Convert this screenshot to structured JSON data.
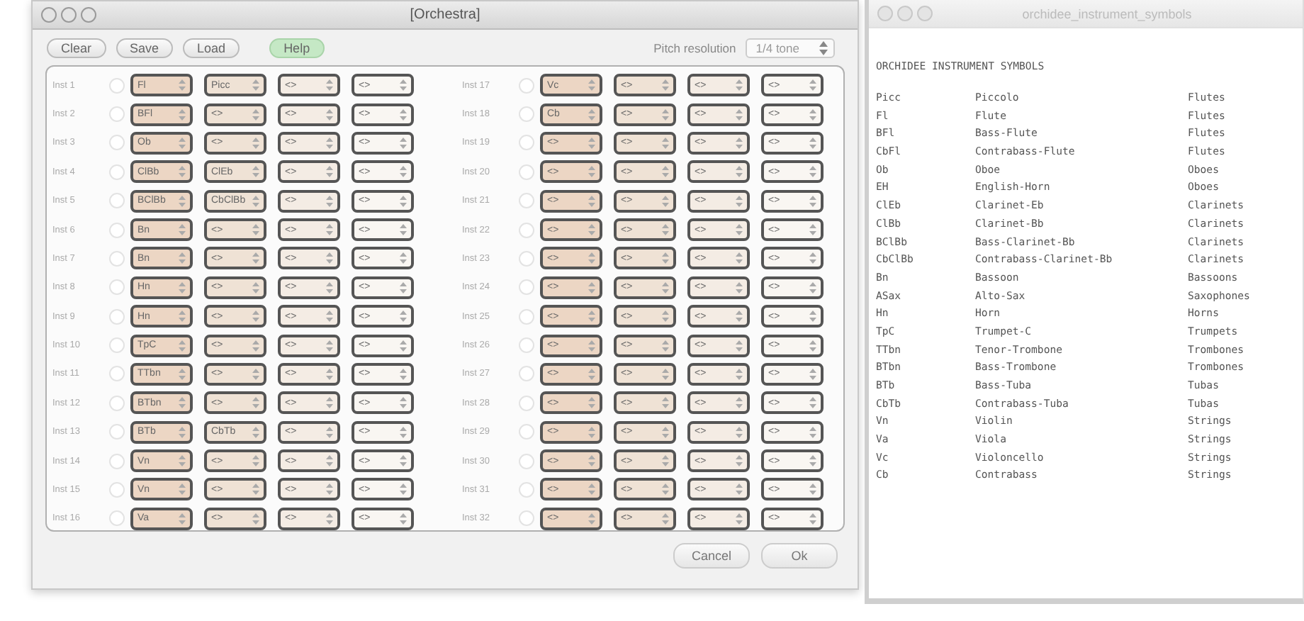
{
  "main_window": {
    "title": "[Orchestra]",
    "toolbar": {
      "buttons": [
        {
          "label": "Clear",
          "kind": "plain"
        },
        {
          "label": "Save",
          "kind": "plain"
        },
        {
          "label": "Load",
          "kind": "plain"
        },
        {
          "label": "Help",
          "kind": "help"
        }
      ],
      "pitch_label": "Pitch resolution",
      "pitch_value": "1/4 tone"
    },
    "instruments": [
      {
        "label": "Inst 1",
        "selected": false,
        "slots": [
          "Fl",
          "Picc",
          "<>",
          "<>"
        ]
      },
      {
        "label": "Inst 2",
        "selected": false,
        "slots": [
          "BFl",
          "<>",
          "<>",
          "<>"
        ]
      },
      {
        "label": "Inst 3",
        "selected": false,
        "slots": [
          "Ob",
          "<>",
          "<>",
          "<>"
        ]
      },
      {
        "label": "Inst 4",
        "selected": false,
        "slots": [
          "ClBb",
          "ClEb",
          "<>",
          "<>"
        ]
      },
      {
        "label": "Inst 5",
        "selected": false,
        "slots": [
          "BClBb",
          "CbClBb",
          "<>",
          "<>"
        ]
      },
      {
        "label": "Inst 6",
        "selected": false,
        "slots": [
          "Bn",
          "<>",
          "<>",
          "<>"
        ]
      },
      {
        "label": "Inst 7",
        "selected": false,
        "slots": [
          "Bn",
          "<>",
          "<>",
          "<>"
        ]
      },
      {
        "label": "Inst 8",
        "selected": false,
        "slots": [
          "Hn",
          "<>",
          "<>",
          "<>"
        ]
      },
      {
        "label": "Inst 9",
        "selected": false,
        "slots": [
          "Hn",
          "<>",
          "<>",
          "<>"
        ]
      },
      {
        "label": "Inst 10",
        "selected": false,
        "slots": [
          "TpC",
          "<>",
          "<>",
          "<>"
        ]
      },
      {
        "label": "Inst 11",
        "selected": false,
        "slots": [
          "TTbn",
          "<>",
          "<>",
          "<>"
        ]
      },
      {
        "label": "Inst 12",
        "selected": false,
        "slots": [
          "BTbn",
          "<>",
          "<>",
          "<>"
        ]
      },
      {
        "label": "Inst 13",
        "selected": false,
        "slots": [
          "BTb",
          "CbTb",
          "<>",
          "<>"
        ]
      },
      {
        "label": "Inst 14",
        "selected": false,
        "slots": [
          "Vn",
          "<>",
          "<>",
          "<>"
        ]
      },
      {
        "label": "Inst 15",
        "selected": false,
        "slots": [
          "Vn",
          "<>",
          "<>",
          "<>"
        ]
      },
      {
        "label": "Inst 16",
        "selected": false,
        "slots": [
          "Va",
          "<>",
          "<>",
          "<>"
        ]
      },
      {
        "label": "Inst 17",
        "selected": false,
        "slots": [
          "Vc",
          "<>",
          "<>",
          "<>"
        ]
      },
      {
        "label": "Inst 18",
        "selected": false,
        "slots": [
          "Cb",
          "<>",
          "<>",
          "<>"
        ]
      },
      {
        "label": "Inst 19",
        "selected": false,
        "slots": [
          "<>",
          "<>",
          "<>",
          "<>"
        ]
      },
      {
        "label": "Inst 20",
        "selected": false,
        "slots": [
          "<>",
          "<>",
          "<>",
          "<>"
        ]
      },
      {
        "label": "Inst 21",
        "selected": false,
        "slots": [
          "<>",
          "<>",
          "<>",
          "<>"
        ]
      },
      {
        "label": "Inst 22",
        "selected": false,
        "slots": [
          "<>",
          "<>",
          "<>",
          "<>"
        ]
      },
      {
        "label": "Inst 23",
        "selected": false,
        "slots": [
          "<>",
          "<>",
          "<>",
          "<>"
        ]
      },
      {
        "label": "Inst 24",
        "selected": false,
        "slots": [
          "<>",
          "<>",
          "<>",
          "<>"
        ]
      },
      {
        "label": "Inst 25",
        "selected": false,
        "slots": [
          "<>",
          "<>",
          "<>",
          "<>"
        ]
      },
      {
        "label": "Inst 26",
        "selected": false,
        "slots": [
          "<>",
          "<>",
          "<>",
          "<>"
        ]
      },
      {
        "label": "Inst 27",
        "selected": false,
        "slots": [
          "<>",
          "<>",
          "<>",
          "<>"
        ]
      },
      {
        "label": "Inst 28",
        "selected": false,
        "slots": [
          "<>",
          "<>",
          "<>",
          "<>"
        ]
      },
      {
        "label": "Inst 29",
        "selected": false,
        "slots": [
          "<>",
          "<>",
          "<>",
          "<>"
        ]
      },
      {
        "label": "Inst 30",
        "selected": false,
        "slots": [
          "<>",
          "<>",
          "<>",
          "<>"
        ]
      },
      {
        "label": "Inst 31",
        "selected": false,
        "slots": [
          "<>",
          "<>",
          "<>",
          "<>"
        ]
      },
      {
        "label": "Inst 32",
        "selected": false,
        "slots": [
          "<>",
          "<>",
          "<>",
          "<>"
        ]
      }
    ],
    "footer_buttons": [
      "Cancel",
      "Ok"
    ]
  },
  "symbols_window": {
    "title": "orchidee_instrument_symbols",
    "heading": "ORCHIDEE INSTRUMENT SYMBOLS",
    "rows": [
      {
        "symbol": "Picc",
        "name": "Piccolo",
        "family": "Flutes"
      },
      {
        "symbol": "Fl",
        "name": "Flute",
        "family": "Flutes"
      },
      {
        "symbol": "BFl",
        "name": "Bass-Flute",
        "family": "Flutes"
      },
      {
        "symbol": "CbFl",
        "name": "Contrabass-Flute",
        "family": "Flutes"
      },
      {
        "symbol": "Ob",
        "name": "Oboe",
        "family": "Oboes"
      },
      {
        "symbol": "EH",
        "name": "English-Horn",
        "family": "Oboes"
      },
      {
        "symbol": "ClEb",
        "name": "Clarinet-Eb",
        "family": "Clarinets"
      },
      {
        "symbol": "ClBb",
        "name": "Clarinet-Bb",
        "family": "Clarinets"
      },
      {
        "symbol": "BClBb",
        "name": "Bass-Clarinet-Bb",
        "family": "Clarinets"
      },
      {
        "symbol": "CbClBb",
        "name": "Contrabass-Clarinet-Bb",
        "family": "Clarinets"
      },
      {
        "symbol": "Bn",
        "name": "Bassoon",
        "family": "Bassoons"
      },
      {
        "symbol": "ASax",
        "name": "Alto-Sax",
        "family": "Saxophones"
      },
      {
        "symbol": "Hn",
        "name": "Horn",
        "family": "Horns"
      },
      {
        "symbol": "TpC",
        "name": "Trumpet-C",
        "family": "Trumpets"
      },
      {
        "symbol": "TTbn",
        "name": "Tenor-Trombone",
        "family": "Trombones"
      },
      {
        "symbol": "BTbn",
        "name": "Bass-Trombone",
        "family": "Trombones"
      },
      {
        "symbol": "BTb",
        "name": "Bass-Tuba",
        "family": "Tubas"
      },
      {
        "symbol": "CbTb",
        "name": "Contrabass-Tuba",
        "family": "Tubas"
      },
      {
        "symbol": "Vn",
        "name": "Violin",
        "family": "Strings"
      },
      {
        "symbol": "Va",
        "name": "Viola",
        "family": "Strings"
      },
      {
        "symbol": "Vc",
        "name": "Violoncello",
        "family": "Strings"
      },
      {
        "symbol": "Cb",
        "name": "Contrabass",
        "family": "Strings"
      }
    ]
  }
}
